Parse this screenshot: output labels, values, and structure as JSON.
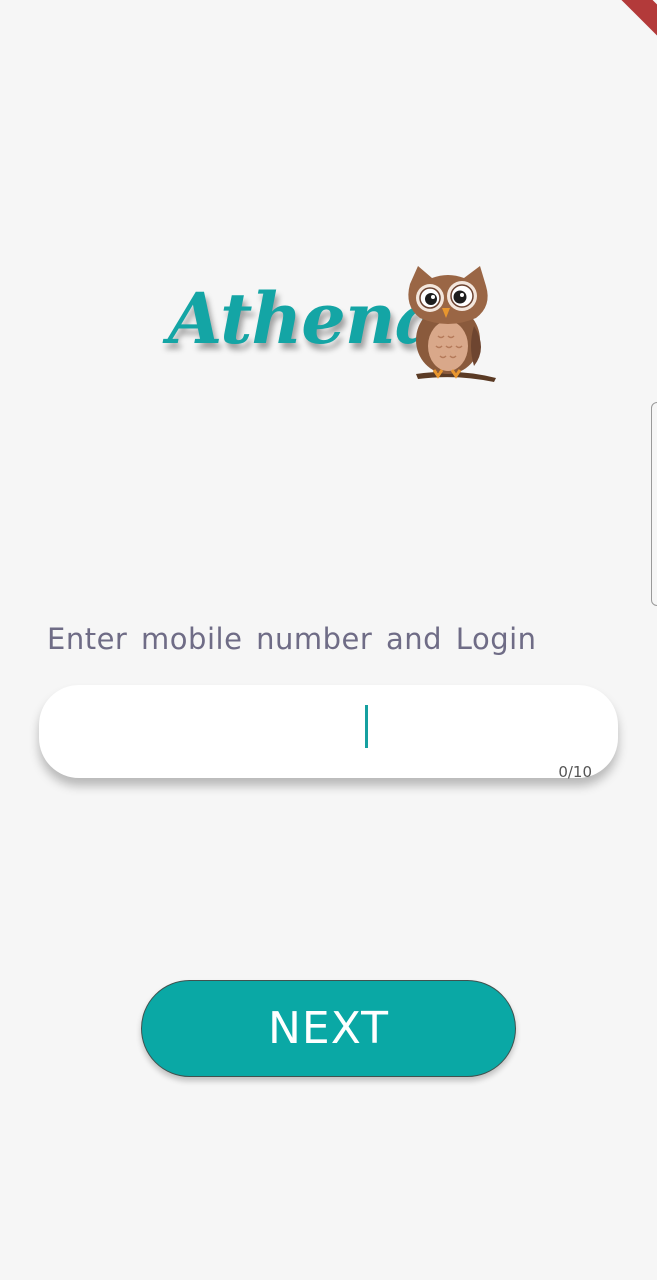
{
  "app": {
    "logo_text": "Athena",
    "logo_icon": "owl-icon",
    "brand_color": "#14a5a5"
  },
  "login": {
    "prompt": "Enter mobile number and Login",
    "phone_value": "",
    "char_counter": "0/10",
    "next_label": "NEXT"
  },
  "colors": {
    "background": "#f6f6f6",
    "button": "#0aa8a5",
    "prompt_text": "#6f6c86",
    "debug_ribbon": "#b33a3a"
  }
}
